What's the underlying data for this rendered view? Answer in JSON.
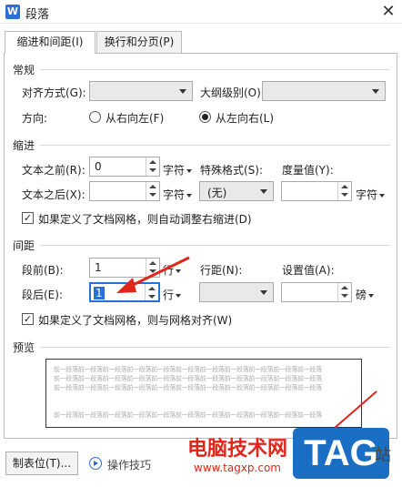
{
  "window": {
    "title": "段落",
    "logo_letter": "W",
    "close_glyph": "✕"
  },
  "tabs": [
    {
      "label": "缩进和间距(I)",
      "active": true
    },
    {
      "label": "换行和分页(P)",
      "active": false
    }
  ],
  "general": {
    "title": "常规",
    "alignment_label": "对齐方式(G):",
    "alignment_value": "",
    "outline_label": "大纲级别(O):",
    "outline_value": "",
    "direction_label": "方向:",
    "rtl_label": "从右向左(F)",
    "ltr_label": "从左向右(L)",
    "selected_direction": "ltr"
  },
  "indent": {
    "title": "缩进",
    "before_label": "文本之前(R):",
    "before_value": "0",
    "before_unit": "字符",
    "special_label": "特殊格式(S):",
    "special_value": "(无)",
    "measure_label": "度量值(Y):",
    "measure_value": "",
    "measure_unit": "字符",
    "after_label": "文本之后(X):",
    "after_value": "",
    "after_unit": "字符",
    "auto_adjust_label": "如果定义了文档网格，则自动调整右缩进(D)",
    "auto_adjust_checked": true
  },
  "spacing": {
    "title": "间距",
    "before_label": "段前(B):",
    "before_value": "1",
    "before_unit": "行",
    "line_spacing_label": "行距(N):",
    "line_spacing_value": "",
    "set_value_label": "设置值(A):",
    "set_value": "",
    "set_value_unit": "磅",
    "after_label": "段后(E):",
    "after_value": "1",
    "after_unit": "行",
    "snap_grid_label": "如果定义了文档网格，则与网格对齐(W)",
    "snap_grid_checked": true
  },
  "preview": {
    "title": "预览",
    "line_text": "前一段落前一段落前一段落前一段落前一段落前一段落前一段落前一段落前一段落前一段落前一段落"
  },
  "footer": {
    "tabs_button": "制表位(T)...",
    "tips_label": "操作技巧"
  },
  "watermark": {
    "site_name": "电脑技术网",
    "url": "www.tagxp.com",
    "tag": "TAG",
    "suffix": "站"
  },
  "colors": {
    "accent": "#2b6fd6",
    "annotation_arrow": "#e0251b",
    "watermark_red": "#e0251b",
    "tag_blue": "#1a6fc4"
  }
}
